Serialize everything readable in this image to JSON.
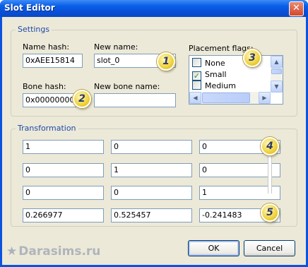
{
  "window": {
    "title": "Slot Editor",
    "close_glyph": "✕"
  },
  "settings": {
    "legend": "Settings",
    "name_hash": {
      "label": "Name hash:",
      "value": "0xAEE15814"
    },
    "new_name": {
      "label": "New name:",
      "value": "slot_0"
    },
    "bone_hash": {
      "label": "Bone hash:",
      "value": "0x00000000"
    },
    "new_bone_name": {
      "label": "New bone name:",
      "value": ""
    },
    "placement_flags": {
      "label": "Placement flags:",
      "items": [
        {
          "label": "None",
          "checked": false
        },
        {
          "label": "Small",
          "checked": true
        },
        {
          "label": "Medium",
          "checked": false
        }
      ]
    }
  },
  "transformation": {
    "legend": "Transformation",
    "rows": [
      [
        "1",
        "0",
        "0"
      ],
      [
        "0",
        "1",
        "0"
      ],
      [
        "0",
        "0",
        "1"
      ],
      [
        "0.266977",
        "0.525457",
        "-0.241483"
      ]
    ]
  },
  "badges": [
    "1",
    "2",
    "3",
    "4",
    "5"
  ],
  "buttons": {
    "ok": "OK",
    "cancel": "Cancel"
  },
  "watermark": {
    "text": "Darasims.ru",
    "star": "★"
  },
  "colors": {
    "title_bar": "#0a5fe8",
    "dialog_bg": "#ece9d8",
    "legend_text": "#1f4aa8",
    "badge": "#f0d23a"
  }
}
